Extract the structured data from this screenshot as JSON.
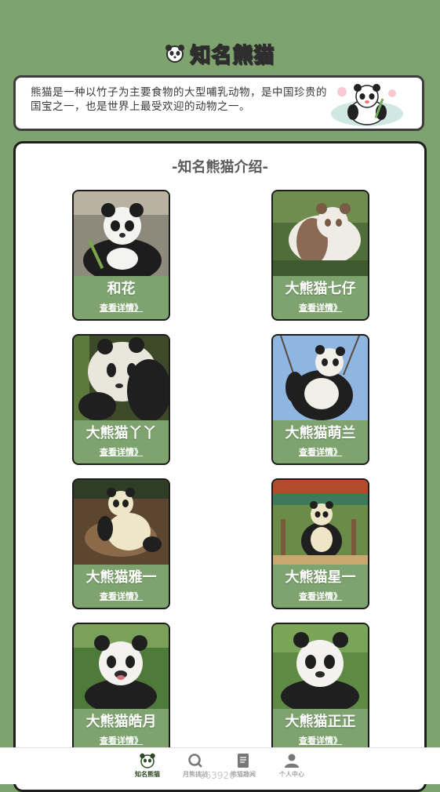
{
  "header": {
    "title": "知名熊猫",
    "icon": "panda-icon"
  },
  "intro": {
    "text": "熊猫是一种以竹子为主要食物的大型哺乳动物，是中国珍贵的国宝之一，也是世界上最受欢迎的动物之一。",
    "image": "panda-eating-bamboo-illustration"
  },
  "panel": {
    "heading": "-知名熊猫介绍-",
    "cards": [
      {
        "name": "和花",
        "more": "查看详情》",
        "photo": "panda-photo-hehua"
      },
      {
        "name": "大熊猫七仔",
        "more": "查看详情》",
        "photo": "panda-photo-qizai"
      },
      {
        "name": "大熊猫丫丫",
        "more": "查看详情》",
        "photo": "panda-photo-yaya"
      },
      {
        "name": "大熊猫萌兰",
        "more": "查看详情》",
        "photo": "panda-photo-menglan"
      },
      {
        "name": "大熊猫雅一",
        "more": "查看详情》",
        "photo": "panda-photo-yayi"
      },
      {
        "name": "大熊猫星一",
        "more": "查看详情》",
        "photo": "panda-photo-xingyi"
      },
      {
        "name": "大熊猫皓月",
        "more": "查看详情》",
        "photo": "panda-photo-haoyue"
      },
      {
        "name": "大熊猫正正",
        "more": "查看详情》",
        "photo": "panda-photo-zhengzheng"
      }
    ]
  },
  "nav": {
    "items": [
      {
        "label": "知名熊猫",
        "icon": "panda-icon",
        "active": true
      },
      {
        "label": "月熊挑战",
        "icon": "search-icon",
        "active": false
      },
      {
        "label": "熊猫趣闻",
        "icon": "book-icon",
        "active": false
      },
      {
        "label": "个人中心",
        "icon": "user-icon",
        "active": false
      }
    ]
  },
  "watermark": "663920",
  "colors": {
    "background": "#7ea36f",
    "card_border": "#1c1c1c",
    "text_dark": "#3a3a3a"
  }
}
